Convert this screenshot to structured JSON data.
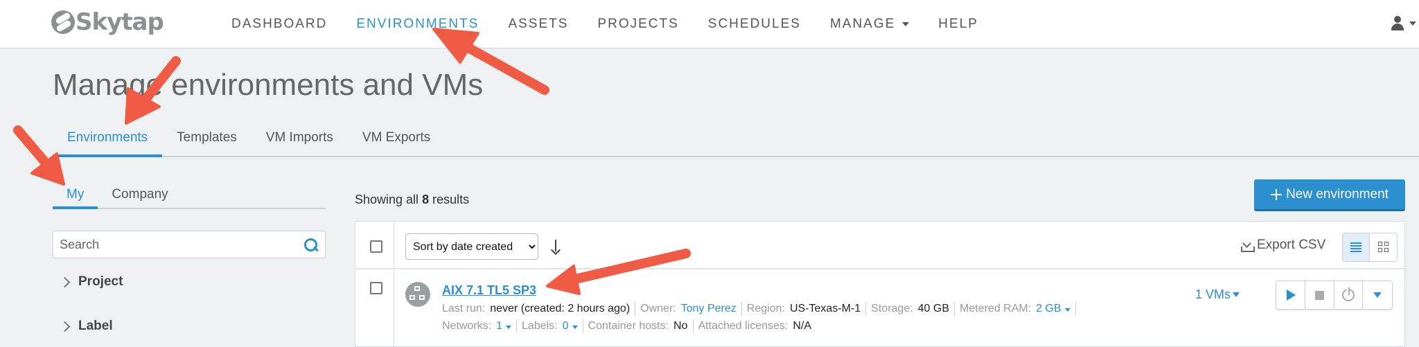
{
  "brand": {
    "name": "Skytap"
  },
  "nav": {
    "items": [
      {
        "label": "DASHBOARD"
      },
      {
        "label": "ENVIRONMENTS"
      },
      {
        "label": "ASSETS"
      },
      {
        "label": "PROJECTS"
      },
      {
        "label": "SCHEDULES"
      },
      {
        "label": "MANAGE"
      },
      {
        "label": "HELP"
      }
    ],
    "active": "ENVIRONMENTS"
  },
  "page": {
    "title": "Manage environments and VMs"
  },
  "main_tabs": [
    {
      "label": "Environments"
    },
    {
      "label": "Templates"
    },
    {
      "label": "VM Imports"
    },
    {
      "label": "VM Exports"
    }
  ],
  "sub_tabs": [
    {
      "label": "My"
    },
    {
      "label": "Company"
    }
  ],
  "sidebar": {
    "search_placeholder": "Search",
    "facets": [
      {
        "label": "Project"
      },
      {
        "label": "Label"
      }
    ]
  },
  "results": {
    "prefix": "Showing all",
    "count": "8",
    "suffix": "results"
  },
  "toolbar": {
    "new_environment_label": "New environment",
    "sort_options": [
      "Sort by date created"
    ],
    "export_label": "Export CSV"
  },
  "environment": {
    "name": "AIX 7.1 TL5 SP3",
    "last_run_label": "Last run:",
    "last_run_value": "never (created: 2 hours ago)",
    "owner_label": "Owner:",
    "owner_value": "Tony Perez",
    "region_label": "Region:",
    "region_value": "US-Texas-M-1",
    "storage_label": "Storage:",
    "storage_value": "40 GB",
    "ram_label": "Metered RAM:",
    "ram_value": "2 GB",
    "networks_label": "Networks:",
    "networks_value": "1",
    "labels_label": "Labels:",
    "labels_value": "0",
    "container_label": "Container hosts:",
    "container_value": "No",
    "licenses_label": "Attached licenses:",
    "licenses_value": "N/A",
    "vm_count": "1 VMs"
  },
  "colors": {
    "accent": "#2b8fd0",
    "annotation_arrow": "#ef5b45",
    "page_background": "#eef1f2"
  }
}
